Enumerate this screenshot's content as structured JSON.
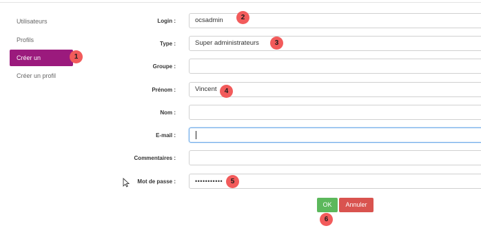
{
  "sidebar": {
    "items": [
      {
        "label": "Utilisateurs"
      },
      {
        "label": "Profils"
      },
      {
        "label": "Créer un utilisateur",
        "active": true
      },
      {
        "label": "Créer un profil"
      }
    ]
  },
  "form": {
    "login": {
      "label": "Login :",
      "value": "ocsadmin"
    },
    "type": {
      "label": "Type :",
      "value": "Super administrateurs"
    },
    "groupe": {
      "label": "Groupe :",
      "value": ""
    },
    "prenom": {
      "label": "Prénom :",
      "value": "Vincent"
    },
    "nom": {
      "label": "Nom :",
      "value": ""
    },
    "email": {
      "label": "E-mail :",
      "value": ""
    },
    "commentaires": {
      "label": "Commentaires :",
      "value": ""
    },
    "password": {
      "label": "Mot de passe :",
      "value": "•••••••••••"
    }
  },
  "buttons": {
    "ok": "OK",
    "cancel": "Annuler"
  },
  "badges": [
    "1",
    "2",
    "3",
    "4",
    "5",
    "6"
  ],
  "colors": {
    "active_nav": "#9b1a7d",
    "badge": "#f25b5b",
    "ok": "#5cb85c",
    "cancel": "#d9534f"
  }
}
